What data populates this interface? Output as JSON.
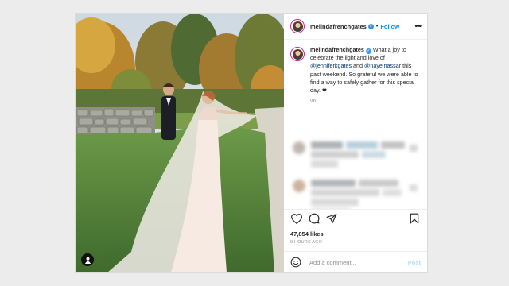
{
  "post": {
    "username": "melindafrenchgates",
    "follow_label": "Follow",
    "more_label": "•••",
    "separator": "•",
    "caption": {
      "username": "melindafrenchgates",
      "part1": " What a joy to celebrate the light and love of ",
      "mention1": "@jenniferkgates",
      "part2": " and ",
      "mention2": "@nayelnassar",
      "part3": " this past weekend. So grateful we were able to find a way to safely gather for this special day. ❤"
    },
    "caption_time": "9h",
    "likes": "47,854 likes",
    "time_ago": "9 HOURS AGO",
    "comment_placeholder": "Add a comment...",
    "post_button": "Post"
  },
  "icons": {
    "verified": "verified-badge-icon",
    "like": "heart-icon",
    "comment": "comment-bubble-icon",
    "share": "paper-plane-icon",
    "save": "bookmark-icon",
    "emoji": "smiley-icon",
    "tagged": "person-icon"
  },
  "colors": {
    "link": "#0095f6",
    "mention": "#00376b",
    "verified": "#3897f0",
    "post_disabled": "#b2dffc"
  }
}
